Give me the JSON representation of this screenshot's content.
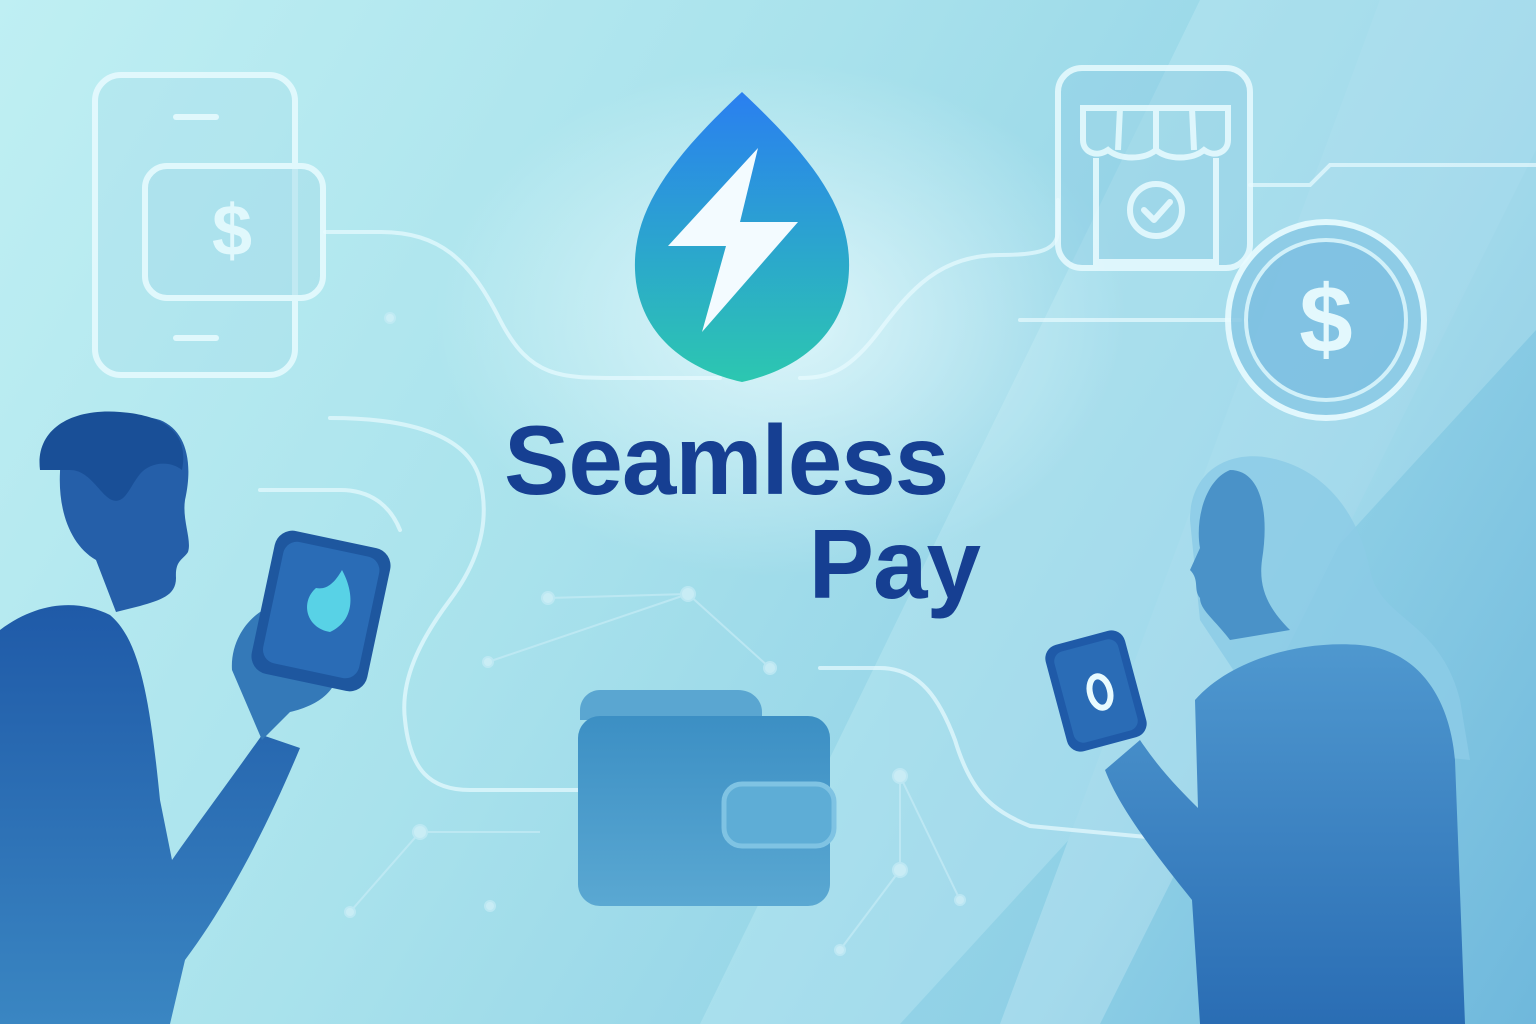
{
  "brand": {
    "name_line1": "Seamless",
    "name_line2": "Pay"
  },
  "icons": {
    "logo": "lightning-drop-logo-icon",
    "payment_device": "phone-payment-icon",
    "storefront": "storefront-check-icon",
    "coin": "dollar-coin-icon",
    "wallet": "wallet-icon",
    "man": "man-with-phone-figure",
    "woman": "woman-with-phone-figure"
  },
  "colors": {
    "title": "#163f92",
    "logo_top": "#2a7ff0",
    "logo_bottom": "#2cc7b0",
    "figure": "#2d6fb3",
    "line": "#e8fbff"
  }
}
